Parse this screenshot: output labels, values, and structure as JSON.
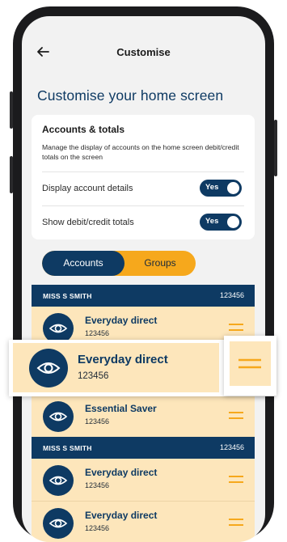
{
  "header": {
    "title": "Customise"
  },
  "page": {
    "title": "Customise your home screen"
  },
  "accounts_totals": {
    "title": "Accounts & totals",
    "description": "Manage the display of accounts on the home screen debit/credit totals on the screen",
    "toggles": [
      {
        "label": "Display account details",
        "value": "Yes"
      },
      {
        "label": "Show debit/credit totals",
        "value": "Yes"
      }
    ]
  },
  "tabs": [
    {
      "label": "Accounts",
      "active": true
    },
    {
      "label": "Groups",
      "active": false
    }
  ],
  "groups": [
    {
      "name": "MISS S SMITH",
      "number": "123456",
      "accounts": [
        {
          "name": "Everyday direct",
          "number": "123456"
        },
        {
          "name": "Essential Saver",
          "number": "123456"
        }
      ]
    },
    {
      "name": "MISS S SMITH",
      "number": "123456",
      "accounts": [
        {
          "name": "Everyday direct",
          "number": "123456"
        },
        {
          "name": "Everyday direct",
          "number": "123456"
        }
      ]
    }
  ],
  "dragging_account": {
    "name": "Everyday direct",
    "number": "123456"
  },
  "colors": {
    "navy": "#0e3a63",
    "accent": "#f6a81c",
    "row_bg": "#fde6bb"
  }
}
